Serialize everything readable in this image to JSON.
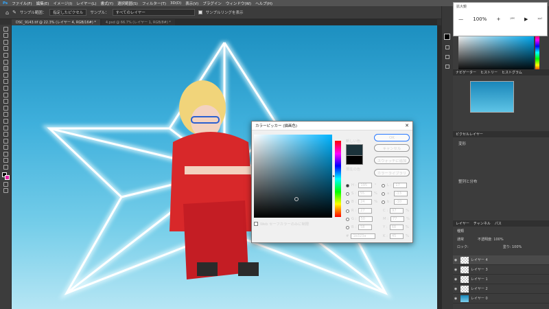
{
  "menu": [
    "ファイル(F)",
    "編集(E)",
    "イメージ(I)",
    "レイヤー(L)",
    "書式(Y)",
    "選択範囲(S)",
    "フィルター(T)",
    "3D(D)",
    "表示(V)",
    "プラグイン",
    "ウィンドウ(W)",
    "ヘルプ(H)"
  ],
  "options": {
    "sample_size_label": "サンプル範囲：",
    "sample_size_value": "指定したピクセル",
    "sample_label": "サンプル：",
    "sample_value": "すべてのレイヤー",
    "ring_label": "サンプルリングを表示"
  },
  "tabs": [
    "DSC_9143.tif @ 22.3% (レイヤー 4, RGB/16#) *",
    "4.psd @ 66.7% (レイヤー 1, RGB/8#) *"
  ],
  "zoom": {
    "title": "拡大鏡",
    "value": "100%",
    "minus": "—",
    "plus": "+"
  },
  "navigator": {
    "tabs": [
      "ナビゲーター",
      "ヒストリー",
      "ヒストグラム"
    ]
  },
  "properties": {
    "tab": "ピクセルレイヤー",
    "transform": "変形",
    "align": "整列と分布"
  },
  "layers": {
    "tabs": [
      "レイヤー",
      "チャンネル",
      "パス"
    ],
    "search": "種類",
    "blend": "通常",
    "opacity_label": "不透明度:",
    "opacity": "100%",
    "lock_label": "ロック:",
    "fill_label": "塗り:",
    "fill": "100%",
    "rows": [
      {
        "name": "レイヤー 4"
      },
      {
        "name": "レイヤー 3"
      },
      {
        "name": "レイヤー 1"
      },
      {
        "name": "レイヤー 2"
      },
      {
        "name": "レイヤー 0"
      }
    ]
  },
  "picker": {
    "title": "カラーピッカー (描画色)",
    "new_label": "新しい色",
    "current_label": "現在の色",
    "ok": "OK",
    "cancel": "キャンセル",
    "add_swatch": "スウォッチに追加",
    "library": "カラーライブラリ",
    "H": "195",
    "S": "55",
    "B": "24",
    "R": "27",
    "G": "50",
    "Bv": "58",
    "L": "17",
    "a": "-13",
    "b": "-10",
    "C": "97",
    "M": "77",
    "Y": "68",
    "K": "45",
    "hex": "1b323a",
    "deg": "°",
    "pct": "%",
    "web_only": "Web セーフカラーのみに制限"
  },
  "colors": {
    "accent": "#00b4ff",
    "new_color": "#1b323a",
    "bg": "#323232"
  }
}
